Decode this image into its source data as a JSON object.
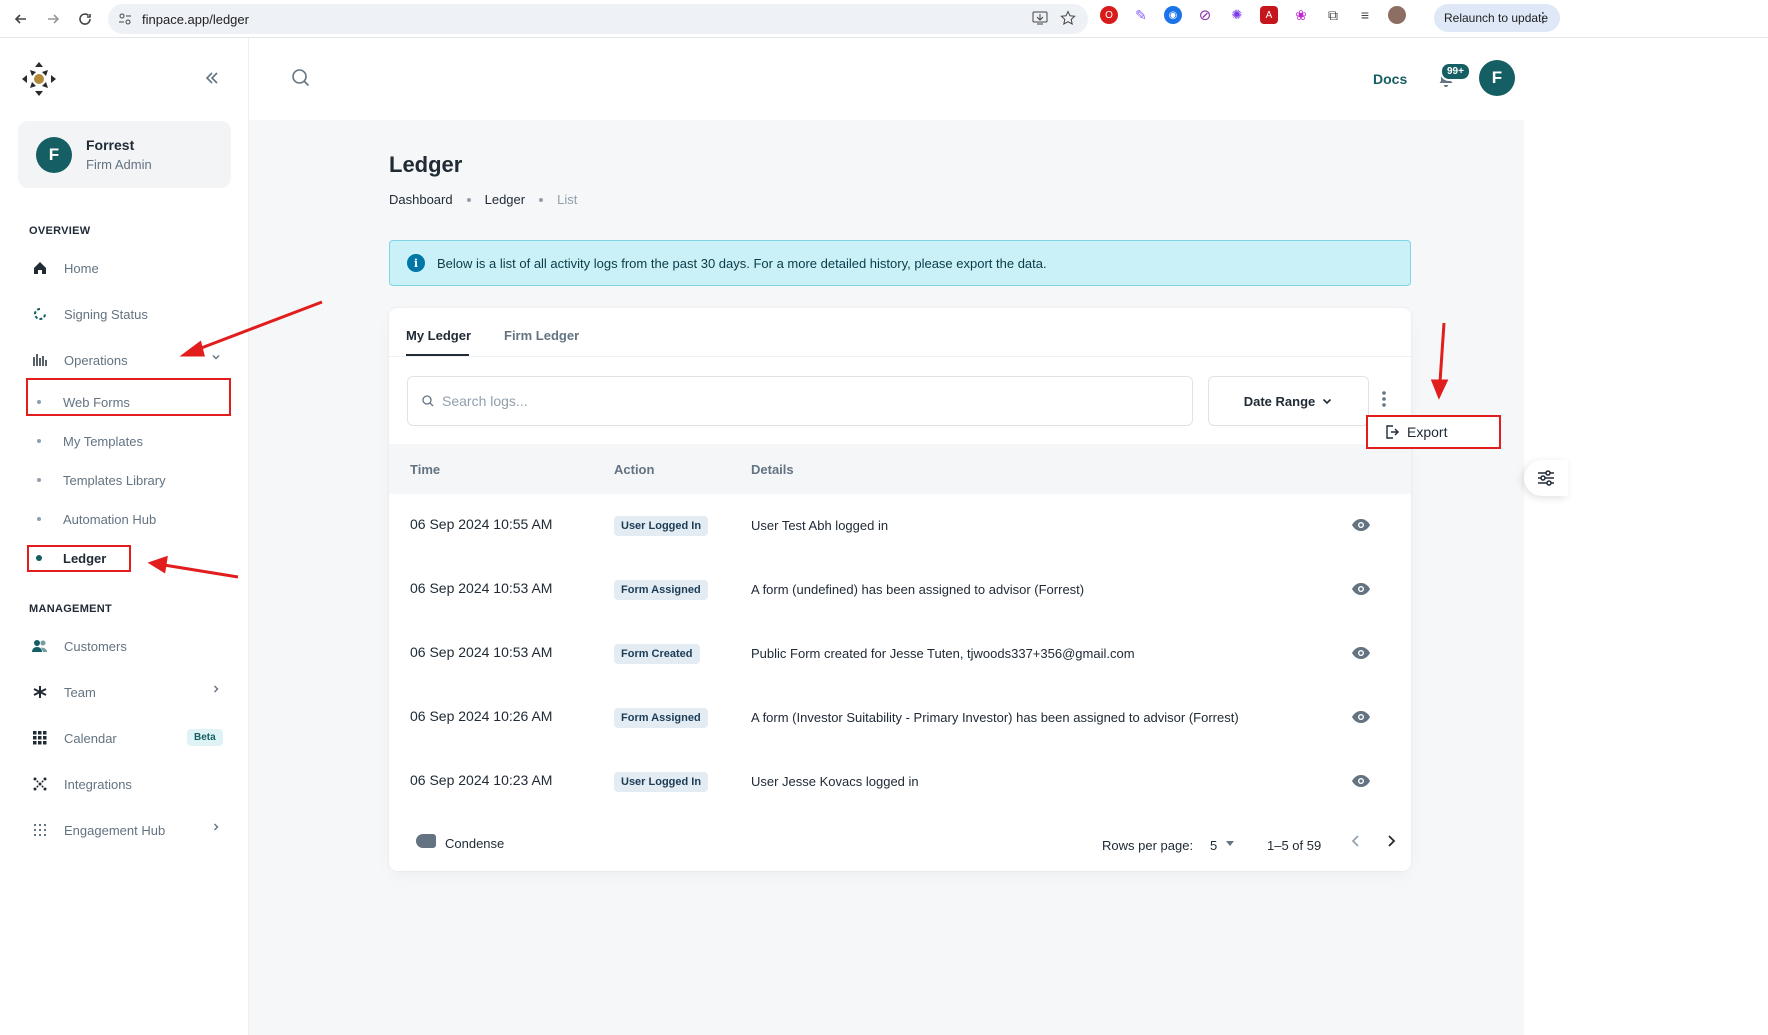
{
  "browser": {
    "url": "finpace.app/ledger",
    "relaunch_label": "Relaunch to update"
  },
  "sidebar": {
    "user": {
      "initial": "F",
      "name": "Forrest",
      "role": "Firm Admin"
    },
    "sections": {
      "overview": "OVERVIEW",
      "management": "MANAGEMENT"
    },
    "overview_items": [
      {
        "label": "Home",
        "icon": "home-icon"
      },
      {
        "label": "Signing Status",
        "icon": "signing-status-icon"
      },
      {
        "label": "Operations",
        "icon": "operations-icon"
      }
    ],
    "operations_sub": [
      {
        "label": "Web Forms"
      },
      {
        "label": "My Templates"
      },
      {
        "label": "Templates Library"
      },
      {
        "label": "Automation Hub"
      },
      {
        "label": "Ledger"
      }
    ],
    "management_items": [
      {
        "label": "Customers",
        "icon": "customers-icon"
      },
      {
        "label": "Team",
        "icon": "team-icon"
      },
      {
        "label": "Calendar",
        "icon": "calendar-icon",
        "badge": "Beta"
      },
      {
        "label": "Integrations",
        "icon": "integrations-icon"
      },
      {
        "label": "Engagement Hub",
        "icon": "engagement-hub-icon"
      }
    ]
  },
  "header": {
    "docs_label": "Docs",
    "notification_count": "99+",
    "avatar_initial": "F"
  },
  "page": {
    "title": "Ledger",
    "breadcrumb": [
      "Dashboard",
      "Ledger",
      "List"
    ],
    "info_text": "Below is a list of all activity logs from the past 30 days. For a more detailed history, please export the data."
  },
  "ledger": {
    "tabs": [
      "My Ledger",
      "Firm Ledger"
    ],
    "search_placeholder": "Search logs...",
    "date_range_label": "Date Range",
    "export_label": "Export",
    "columns": [
      "Time",
      "Action",
      "Details"
    ],
    "rows": [
      {
        "time": "06 Sep 2024 10:55 AM",
        "action": "User Logged In",
        "details": "User Test Abh logged in"
      },
      {
        "time": "06 Sep 2024 10:53 AM",
        "action": "Form Assigned",
        "details": "A form (undefined) has been assigned to advisor (Forrest)"
      },
      {
        "time": "06 Sep 2024 10:53 AM",
        "action": "Form Created",
        "details": "Public Form created for Jesse Tuten, tjwoods337+356@gmail.com"
      },
      {
        "time": "06 Sep 2024 10:26 AM",
        "action": "Form Assigned",
        "details": "A form (Investor Suitability - Primary Investor) has been assigned to advisor (Forrest)"
      },
      {
        "time": "06 Sep 2024 10:23 AM",
        "action": "User Logged In",
        "details": "User Jesse Kovacs logged in"
      }
    ],
    "footer": {
      "condense_label": "Condense",
      "rows_per_page_label": "Rows per page:",
      "rows_per_page_value": "5",
      "range_label": "1–5 of 59"
    }
  },
  "colors": {
    "brand": "#155e63",
    "annotation": "#e11d1d",
    "info_bg": "#caf1f8"
  }
}
